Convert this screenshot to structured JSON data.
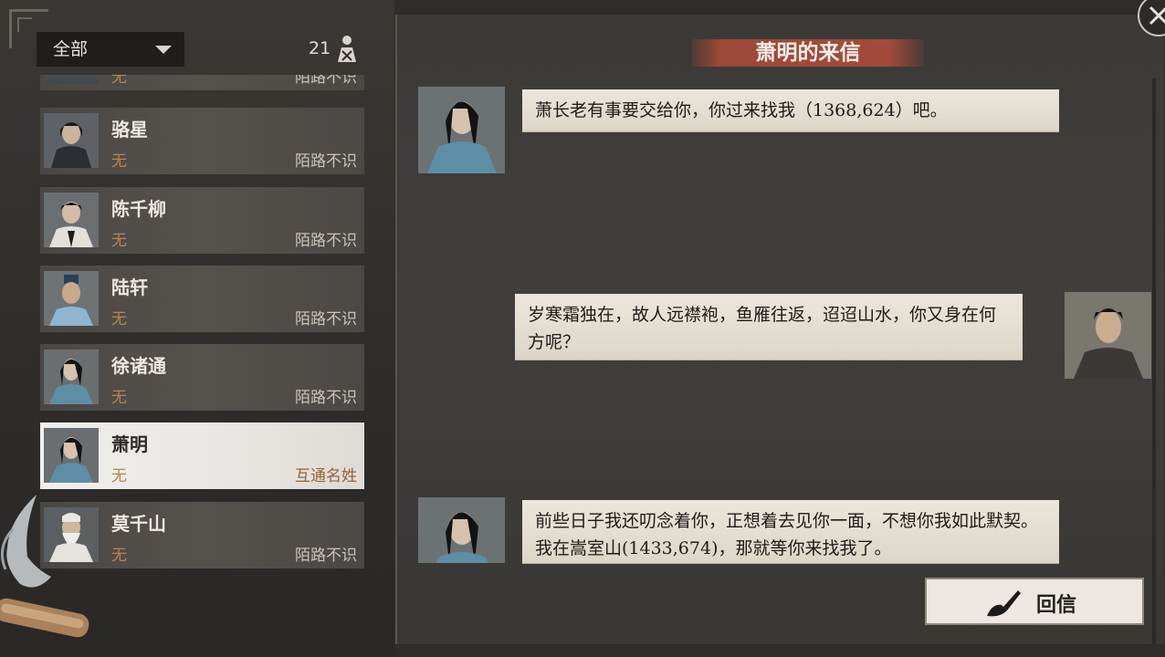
{
  "filter": {
    "label": "全部"
  },
  "contact_count": "21",
  "contacts": [
    {
      "name": "",
      "status": "无",
      "relation": "陌路不识",
      "partial": true
    },
    {
      "name": "骆星",
      "status": "无",
      "relation": "陌路不识"
    },
    {
      "name": "陈千柳",
      "status": "无",
      "relation": "陌路不识"
    },
    {
      "name": "陆轩",
      "status": "无",
      "relation": "陌路不识"
    },
    {
      "name": "徐诸通",
      "status": "无",
      "relation": "陌路不识"
    },
    {
      "name": "萧明",
      "status": "无",
      "relation": "互通名姓",
      "selected": true
    },
    {
      "name": "莫千山",
      "status": "无",
      "relation": "陌路不识"
    }
  ],
  "letter": {
    "title": "萧明的来信",
    "messages": [
      {
        "from": "them",
        "text": "萧长老有事要交给你，你过来找我（1368,624）吧。"
      },
      {
        "from": "me",
        "text": "岁寒霜独在，故人远襟袍，鱼雁往返，迢迢山水，你又身在何方呢？"
      },
      {
        "from": "them",
        "text": "前些日子我还叨念着你，正想着去见你一面，不想你我如此默契。我在嵩室山(1433,674)，那就等你来找我了。"
      }
    ]
  },
  "reply_button": {
    "label": "回信"
  },
  "colors": {
    "status": "#b8864d",
    "banner": "#a24b3b",
    "selected_relation": "#9a6230"
  }
}
